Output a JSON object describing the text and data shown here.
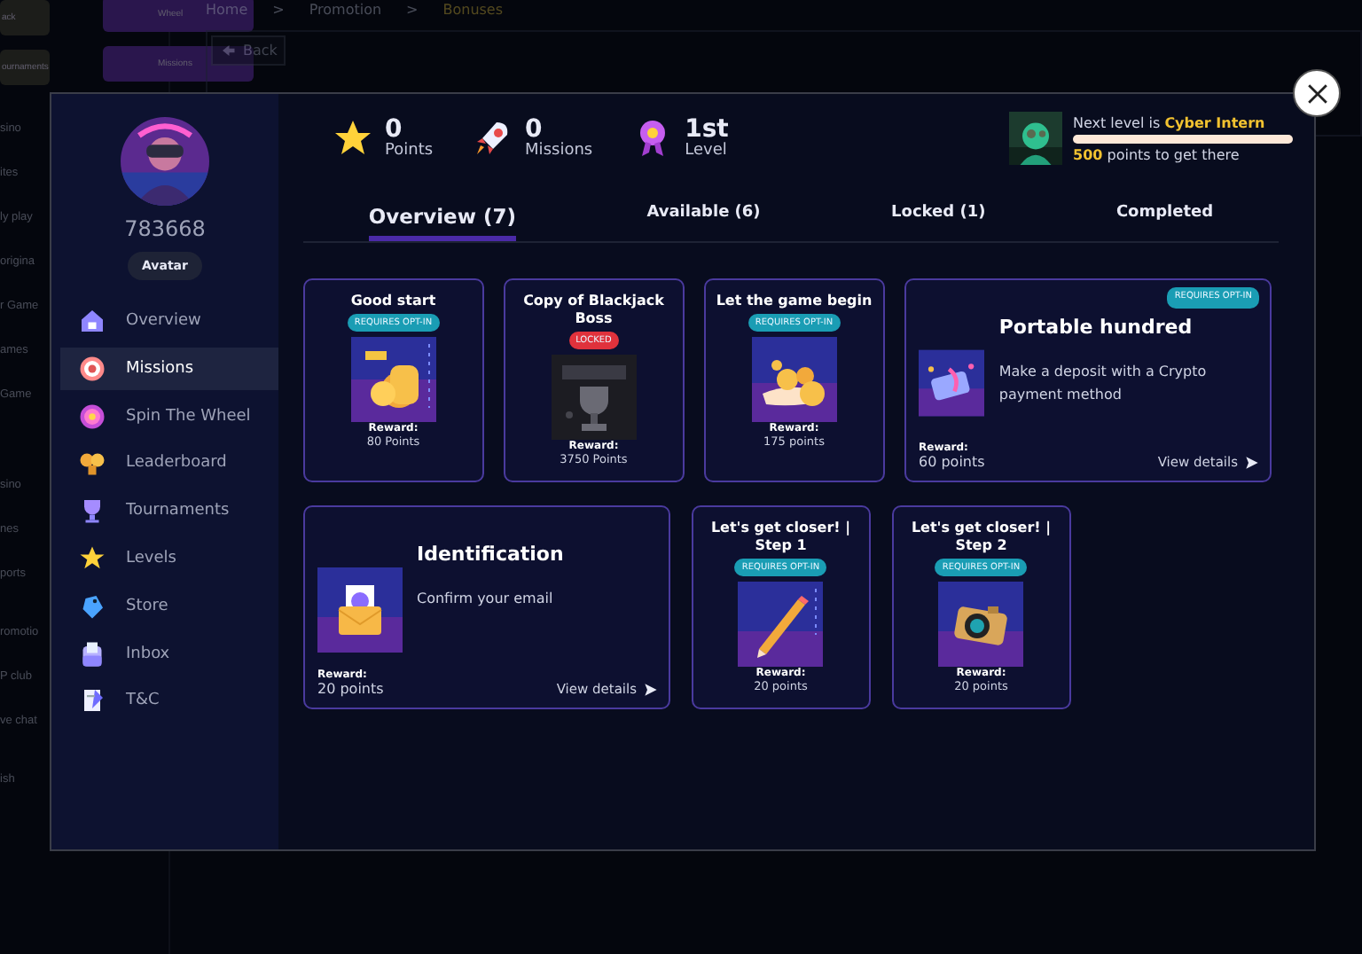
{
  "background": {
    "tiles": [
      {
        "label": "ack"
      },
      {
        "label": "Wheel"
      },
      {
        "label": "ournaments"
      },
      {
        "label": "Missions"
      }
    ],
    "nav": [
      "sino",
      "ites",
      "ly play",
      "origina",
      "r Game",
      "ames",
      "Game",
      "sino",
      "nes",
      "ports",
      "romotio",
      "P club",
      "ve chat",
      "ish"
    ],
    "breadcrumb": [
      "Home",
      ">",
      "Promotion",
      ">",
      "Bonuses"
    ],
    "back_button": "Back"
  },
  "modal": {
    "profile": {
      "user_id": "783668",
      "avatar_button": "Avatar"
    },
    "menu": [
      {
        "label": "Overview",
        "selected": false
      },
      {
        "label": "Missions",
        "selected": true
      },
      {
        "label": "Spin The Wheel",
        "selected": false
      },
      {
        "label": "Leaderboard",
        "selected": false
      },
      {
        "label": "Tournaments",
        "selected": false
      },
      {
        "label": "Levels",
        "selected": false
      },
      {
        "label": "Store",
        "selected": false
      },
      {
        "label": "Inbox",
        "selected": false
      },
      {
        "label": "T&C",
        "selected": false
      }
    ],
    "stats": [
      {
        "value": "0",
        "label": "Points"
      },
      {
        "value": "0",
        "label": "Missions"
      },
      {
        "value": "1st",
        "label": "Level"
      }
    ],
    "next_level": {
      "prefix": "Next level is",
      "name": "Cyber Intern",
      "level": 0,
      "points": "500",
      "suffix": "points to get there"
    },
    "tabs": [
      {
        "label": "Overview (7)",
        "selected": true
      },
      {
        "label": "Available (6)",
        "selected": false
      },
      {
        "label": "Locked (1)",
        "selected": false
      },
      {
        "label": "Completed",
        "selected": false
      }
    ],
    "missions": [
      {
        "kind": "small",
        "title": "Good start",
        "badge": {
          "kind": "optin",
          "text": "REQUIRES OPT-IN"
        },
        "reward_label": "Reward:",
        "reward": "80 Points"
      },
      {
        "kind": "small",
        "title": "Copy of Blackjack Boss",
        "badge": {
          "kind": "locked",
          "text": "LOCKED"
        },
        "reward_label": "Reward:",
        "reward": "3750 Points"
      },
      {
        "kind": "small",
        "title": "Let the game begin",
        "badge": {
          "kind": "optin",
          "text": "REQUIRES OPT-IN"
        },
        "reward_label": "Reward:",
        "reward": "175 points"
      },
      {
        "kind": "wide",
        "title": "Portable hundred",
        "badge": {
          "kind": "optin",
          "text": "REQUIRES OPT-IN"
        },
        "description": "Make a deposit with a Crypto payment method",
        "reward_label": "Reward:",
        "reward": "60 points",
        "link": "View details"
      },
      {
        "kind": "wide",
        "title": "Identification",
        "description": "Confirm your email",
        "reward_label": "Reward:",
        "reward": "20 points",
        "link": "View details"
      },
      {
        "kind": "small",
        "title": "Let's get closer! | Step 1",
        "badge": {
          "kind": "optin",
          "text": "REQUIRES OPT-IN"
        },
        "reward_label": "Reward:",
        "reward": "20 points"
      },
      {
        "kind": "small",
        "title": "Let's get closer! | Step 2",
        "badge": {
          "kind": "optin",
          "text": "REQUIRES OPT-IN"
        },
        "reward_label": "Reward:",
        "reward": "20 points"
      }
    ]
  }
}
